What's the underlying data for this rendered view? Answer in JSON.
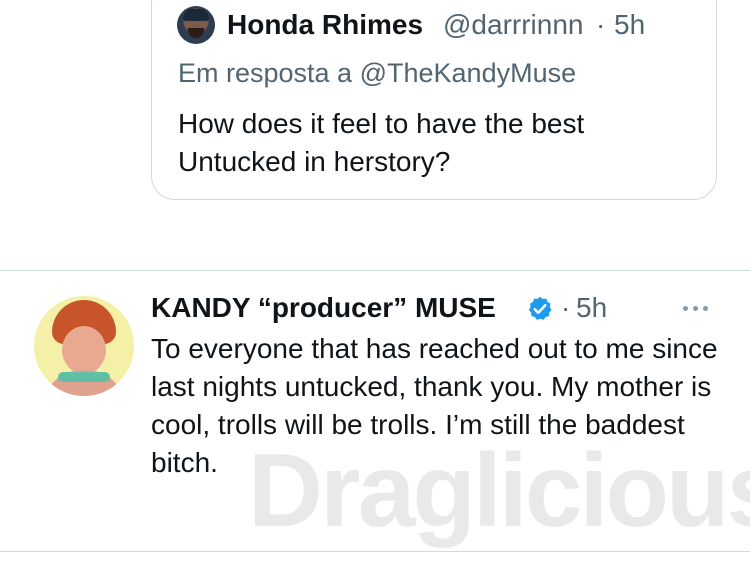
{
  "quoted_tweet": {
    "display_name": "Honda Rhimes",
    "handle": "@darrrinnn",
    "separator": "·",
    "time": "5h",
    "reply_prefix": "Em resposta a",
    "reply_to": "@TheKandyMuse",
    "text": "How does it feel to have the best Untucked in herstory?"
  },
  "main_tweet": {
    "display_name": "KANDY “producer” MUSE",
    "verified": true,
    "separator": "·",
    "time": "5h",
    "text": "To everyone that has reached out to me since last nights untucked, thank you. My mother is cool, trolls will be trolls. I’m still the baddest bitch."
  },
  "watermark": "Draglicious",
  "colors": {
    "text": "#0f1419",
    "secondary": "#536471",
    "border": "#cfd9de",
    "verified": "#1d9bf0"
  },
  "icons": [
    "verified-badge-icon",
    "more-options-icon"
  ]
}
